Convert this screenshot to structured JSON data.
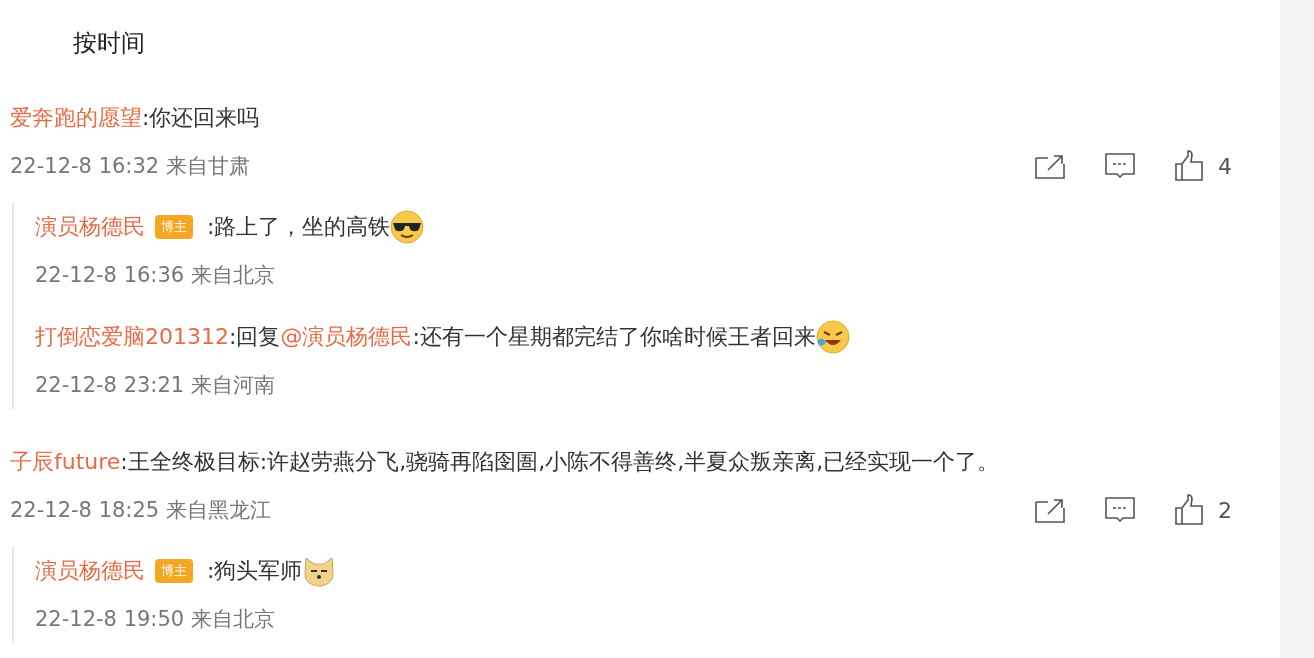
{
  "sort_tab": {
    "label": "按时间"
  },
  "comments": [
    {
      "author": "爱奔跑的愿望",
      "segments": [
        {
          "kind": "plain",
          "text": ":你还回来吗"
        }
      ],
      "meta": "22-12-8 16:32 来自甘肃",
      "likes": "4",
      "replies": [
        {
          "author": "演员杨德民",
          "badge": "博主",
          "segments": [
            {
              "kind": "plain",
              "text": ":路上了，坐的高铁"
            }
          ],
          "emoji": {
            "kind": "sunglasses"
          },
          "meta": "22-12-8 16:36 来自北京"
        },
        {
          "author": "打倒恋爱脑201312",
          "segments": [
            {
              "kind": "plain",
              "text": ":回复"
            },
            {
              "kind": "mention",
              "text": "@演员杨德民"
            },
            {
              "kind": "plain",
              "text": ":还有一个星期都完结了你啥时候王者回来"
            }
          ],
          "emoji": {
            "kind": "crying-laugh"
          },
          "meta": "22-12-8 23:21 来自河南"
        }
      ]
    },
    {
      "author": "子辰future",
      "segments": [
        {
          "kind": "plain",
          "text": ":王全终极目标:许赵劳燕分飞,骁骑再陷囹圄,小陈不得善终,半夏众叛亲离,已经实现一个了。"
        }
      ],
      "meta": "22-12-8 18:25 来自黑龙江",
      "likes": "2",
      "replies": [
        {
          "author": "演员杨德民",
          "badge": "博主",
          "segments": [
            {
              "kind": "plain",
              "text": ":狗头军师"
            }
          ],
          "emoji": {
            "kind": "dog"
          },
          "meta": "22-12-8 19:50 来自北京"
        }
      ]
    }
  ]
}
